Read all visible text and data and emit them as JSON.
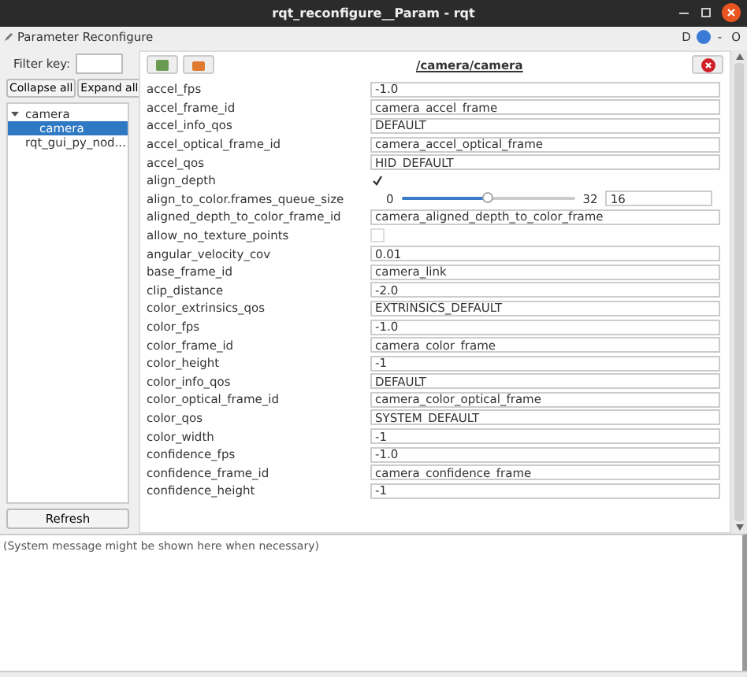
{
  "window": {
    "title": "rqt_reconfigure__Param - rqt"
  },
  "plugin": {
    "title": "Parameter Reconfigure",
    "d_label": "D",
    "minus": "-",
    "o_label": "O"
  },
  "sidebar": {
    "filter_label": "Filter key:",
    "collapse_button": "Collapse all",
    "expand_button": "Expand all",
    "refresh_button": "Refresh",
    "tree": [
      {
        "label": "camera",
        "expanded": true,
        "selected": false,
        "children": [
          {
            "label": "camera",
            "selected": true
          }
        ]
      },
      {
        "label": "rqt_gui_py_nod...",
        "selected": false
      }
    ]
  },
  "panel": {
    "path": "/camera/camera",
    "params": [
      {
        "name": "accel_fps",
        "kind": "text",
        "value": "-1.0"
      },
      {
        "name": "accel_frame_id",
        "kind": "text",
        "value": "camera_accel_frame"
      },
      {
        "name": "accel_info_qos",
        "kind": "text",
        "value": "DEFAULT"
      },
      {
        "name": "accel_optical_frame_id",
        "kind": "text",
        "value": "camera_accel_optical_frame"
      },
      {
        "name": "accel_qos",
        "kind": "text",
        "value": "HID_DEFAULT"
      },
      {
        "name": "align_depth",
        "kind": "check",
        "checked": true
      },
      {
        "name": "align_to_color.frames_queue_size",
        "kind": "slider",
        "min": "0",
        "max": "32",
        "value": "16",
        "level": 0.5
      },
      {
        "name": "aligned_depth_to_color_frame_id",
        "kind": "text",
        "value": "camera_aligned_depth_to_color_frame"
      },
      {
        "name": "allow_no_texture_points",
        "kind": "check",
        "checked": false
      },
      {
        "name": "angular_velocity_cov",
        "kind": "text",
        "value": "0.01"
      },
      {
        "name": "base_frame_id",
        "kind": "text",
        "value": "camera_link"
      },
      {
        "name": "clip_distance",
        "kind": "text",
        "value": "-2.0"
      },
      {
        "name": "color_extrinsics_qos",
        "kind": "text",
        "value": "EXTRINSICS_DEFAULT"
      },
      {
        "name": "color_fps",
        "kind": "text",
        "value": "-1.0"
      },
      {
        "name": "color_frame_id",
        "kind": "text",
        "value": "camera_color_frame"
      },
      {
        "name": "color_height",
        "kind": "text",
        "value": "-1"
      },
      {
        "name": "color_info_qos",
        "kind": "text",
        "value": "DEFAULT"
      },
      {
        "name": "color_optical_frame_id",
        "kind": "text",
        "value": "camera_color_optical_frame"
      },
      {
        "name": "color_qos",
        "kind": "text",
        "value": "SYSTEM_DEFAULT"
      },
      {
        "name": "color_width",
        "kind": "text",
        "value": "-1"
      },
      {
        "name": "confidence_fps",
        "kind": "text",
        "value": "-1.0"
      },
      {
        "name": "confidence_frame_id",
        "kind": "text",
        "value": "camera_confidence_frame"
      },
      {
        "name": "confidence_height",
        "kind": "text",
        "value": "-1"
      }
    ]
  },
  "status_message": "(System message might be shown here when necessary)"
}
